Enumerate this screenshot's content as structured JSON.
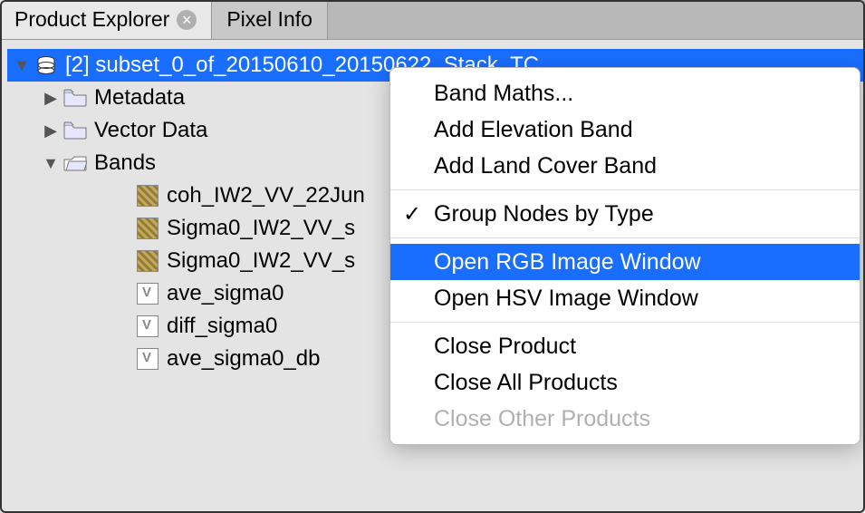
{
  "tabs": {
    "product_explorer": "Product Explorer",
    "pixel_info": "Pixel Info"
  },
  "tree": {
    "product_label": "[2] subset_0_of_20150610_20150622_Stack_TC",
    "metadata": "Metadata",
    "vector_data": "Vector Data",
    "bands": "Bands",
    "band_items": [
      "coh_IW2_VV_22Jun",
      "Sigma0_IW2_VV_s",
      "Sigma0_IW2_VV_s",
      "ave_sigma0",
      "diff_sigma0",
      "ave_sigma0_db"
    ]
  },
  "menu": {
    "band_maths": "Band Maths...",
    "add_elevation": "Add Elevation Band",
    "add_landcover": "Add Land Cover Band",
    "group_nodes": "Group Nodes by Type",
    "open_rgb": "Open RGB Image Window",
    "open_hsv": "Open HSV Image Window",
    "close_product": "Close Product",
    "close_all": "Close All Products",
    "close_other": "Close Other Products"
  }
}
